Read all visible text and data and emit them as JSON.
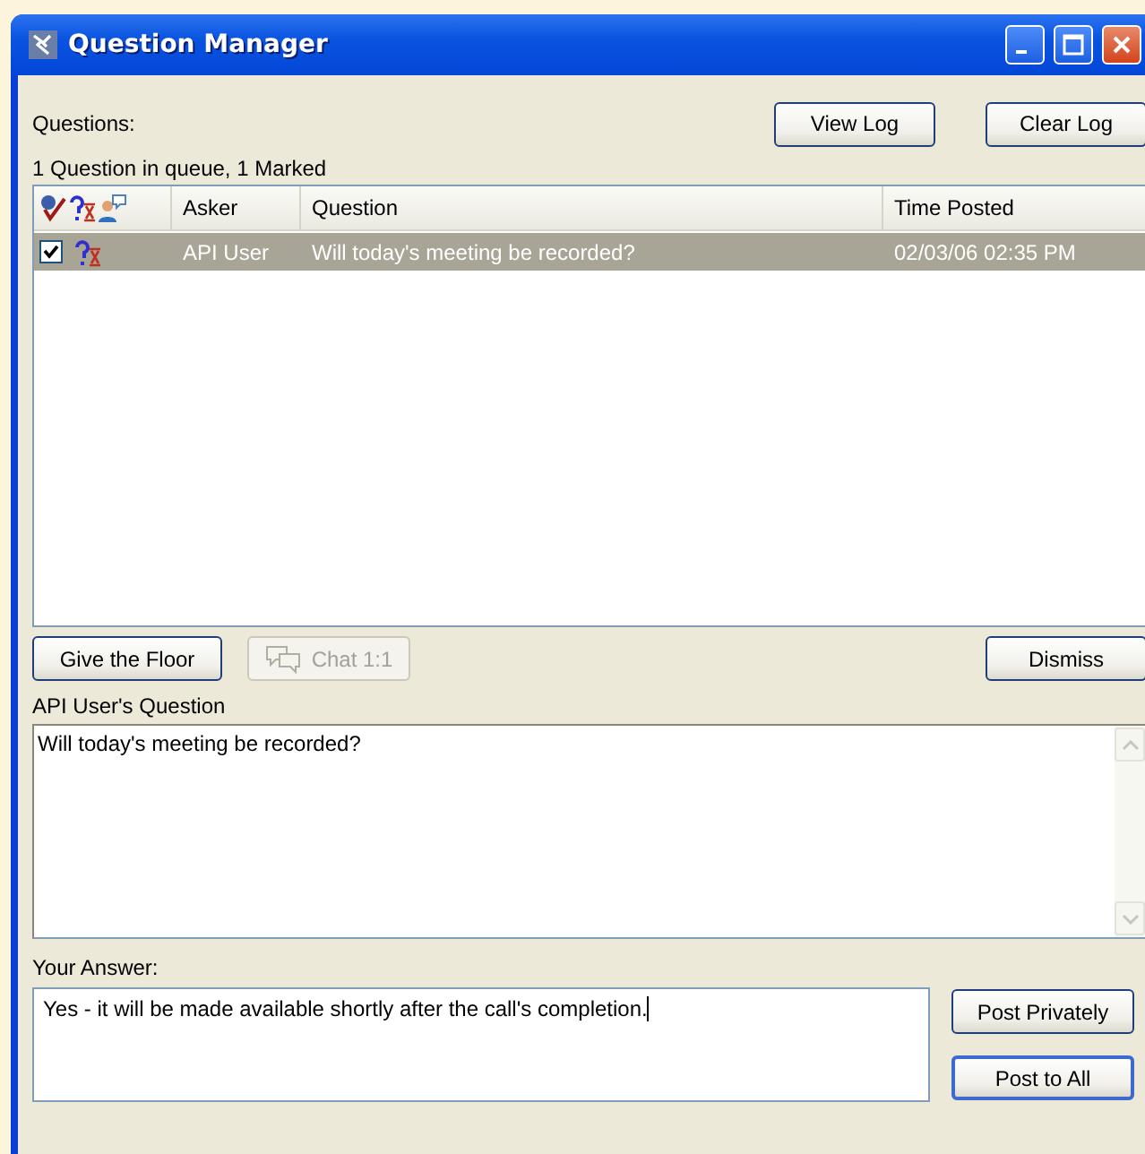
{
  "window": {
    "title": "Question Manager"
  },
  "questions_label": "Questions:",
  "top_buttons": [
    {
      "label": "View Log",
      "disabled": false
    },
    {
      "label": "Clear Log",
      "disabled": false
    }
  ],
  "queue_status": "1 Question in queue, 1 Marked",
  "table": {
    "columns": [
      "Asker",
      "Question",
      "Time Posted"
    ],
    "rows": [
      {
        "checked": true,
        "selected": true,
        "asker": "API User",
        "question": "Will today's meeting be recorded?",
        "time": "02/03/06 02:35 PM"
      }
    ]
  },
  "action_buttons": [
    {
      "label": "Give the Floor",
      "disabled": false,
      "kind": "text"
    },
    {
      "label": "Chat 1:1",
      "disabled": true,
      "kind": "chat"
    },
    {
      "label": "Dismiss",
      "disabled": false,
      "kind": "text"
    }
  ],
  "question_label": "API User's Question",
  "question_text": "Will today's meeting be recorded?",
  "answer_label": "Your Answer:",
  "answer_text": "Yes - it will be made available shortly after the call's completion.",
  "post_buttons": [
    {
      "label": "Post Privately",
      "disabled": false
    },
    {
      "label": "Post to All",
      "disabled": false
    }
  ]
}
